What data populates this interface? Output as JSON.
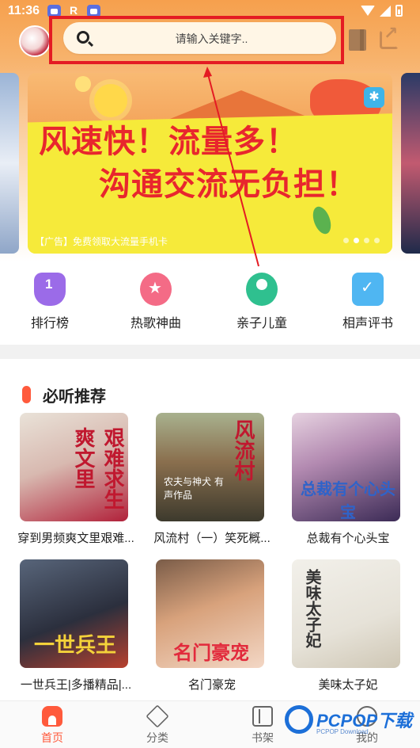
{
  "status_bar": {
    "time": "11:36",
    "r_indicator": "R"
  },
  "header": {
    "search_placeholder": "请输入关键字..",
    "icons": [
      "avatar",
      "search-icon",
      "bookmark-icon",
      "share-icon"
    ]
  },
  "banner": {
    "line1": "风速快！流量多！",
    "line2": "沟通交流无负担！",
    "ad_caption": "【广告】免费领取大流量手机卡",
    "dots": 4,
    "active_dot": 2
  },
  "categories": [
    {
      "label": "排行榜",
      "icon": "trophy-icon"
    },
    {
      "label": "热歌神曲",
      "icon": "hot-song-icon"
    },
    {
      "label": "亲子儿童",
      "icon": "family-icon"
    },
    {
      "label": "相声评书",
      "icon": "crosstalk-icon"
    }
  ],
  "recommend": {
    "title": "必听推荐",
    "books": [
      {
        "title": "穿到男频爽文里艰难...",
        "cover_text": "艰难求生 爽文里"
      },
      {
        "title": "风流村（一）笑死概...",
        "cover_text": "风流村",
        "cover_sub": "农夫与神犬 有声作品"
      },
      {
        "title": "总裁有个心头宝",
        "cover_text": "总裁有个心头宝"
      },
      {
        "title": "一世兵王|多播精品|...",
        "cover_text": "一世兵王"
      },
      {
        "title": "名门豪宠",
        "cover_text": "名门豪宠"
      },
      {
        "title": "美味太子妃",
        "cover_text": "美味太子妃"
      }
    ]
  },
  "bottom_nav": [
    {
      "label": "首页",
      "active": true
    },
    {
      "label": "分类",
      "active": false
    },
    {
      "label": "书架",
      "active": false
    },
    {
      "label": "我的",
      "active": false
    }
  ],
  "watermark": {
    "brand": "PCPOP下载",
    "sub": "PCPOP Download"
  },
  "colors": {
    "accent": "#ff5a3c",
    "annotation": "#e41b23",
    "header_gradient_top": "#f6a04d"
  }
}
